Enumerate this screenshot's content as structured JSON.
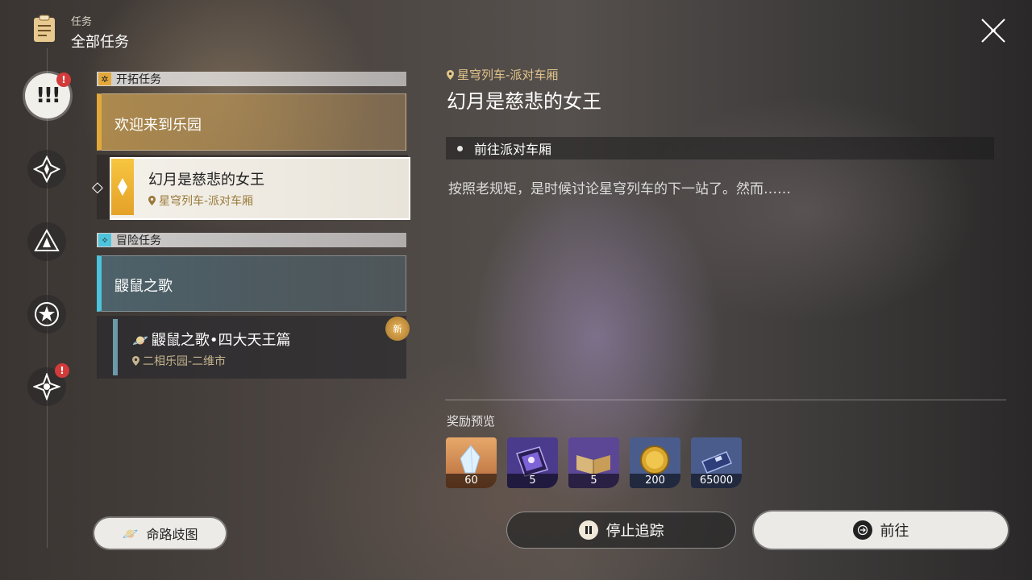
{
  "header": {
    "category_label": "任务",
    "title": "全部任务"
  },
  "rail": {
    "badges": [
      "!",
      "!"
    ]
  },
  "sections": [
    {
      "header": "开拓任务",
      "accent": "#e2a93a",
      "quests": [
        {
          "title": "欢迎来到乐园"
        },
        {
          "title": "幻月是慈悲的女王",
          "location": "星穹列车-派对车厢",
          "selected": true
        }
      ]
    },
    {
      "header": "冒险任务",
      "accent": "#4cc4dc",
      "quests": [
        {
          "title": "鼹鼠之歌"
        },
        {
          "title": "鼹鼠之歌•四大天王篇",
          "location": "二相乐园-二维市",
          "new_badge": "新"
        }
      ]
    }
  ],
  "path_button": "命路歧图",
  "detail": {
    "location": "星穹列车-派对车厢",
    "title": "幻月是慈悲的女王",
    "step": "前往派对车厢",
    "description": "按照老规矩，是时候讨论星穹列车的下一站了。然而……",
    "rewards_label": "奖励预览",
    "rewards": [
      {
        "icon": "crystal-icon",
        "count": "60"
      },
      {
        "icon": "purple-book-icon",
        "count": "5"
      },
      {
        "icon": "open-book-icon",
        "count": "5"
      },
      {
        "icon": "gold-coin-icon",
        "count": "200"
      },
      {
        "icon": "credit-card-icon",
        "count": "65000"
      }
    ]
  },
  "buttons": {
    "stop_tracking": "停止追踪",
    "go": "前往"
  }
}
